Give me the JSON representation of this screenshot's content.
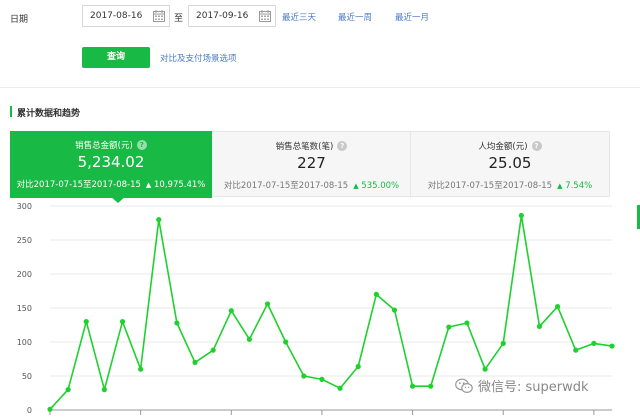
{
  "filter": {
    "date_label": "日期",
    "start_date": "2017-08-16",
    "separator": "至",
    "end_date": "2017-09-16",
    "quick_ranges": [
      "最近三天",
      "最近一周",
      "最近一月"
    ],
    "query_button": "查询",
    "compare_link": "对比及支付场景选项"
  },
  "section": {
    "title": "累计数据和趋势"
  },
  "cards": [
    {
      "title": "销售总金额(元)",
      "value": "5,234.02",
      "compare_text": "对比2017-07-15至2017-08-15",
      "change": "10,975.41%",
      "active": true
    },
    {
      "title": "销售总笔数(笔)",
      "value": "227",
      "compare_text": "对比2017-07-15至2017-08-15",
      "change": "535.00%",
      "active": false
    },
    {
      "title": "人均金额(元)",
      "value": "25.05",
      "compare_text": "对比2017-07-15至2017-08-15",
      "change": "7.54%",
      "active": false
    }
  ],
  "chart_data": {
    "type": "line",
    "ylim": [
      0,
      300
    ],
    "y_ticks": [
      "0",
      "50",
      "100",
      "150",
      "200",
      "250",
      "300"
    ],
    "grid": true,
    "series_color": "#1fd12e",
    "values": [
      1,
      30,
      130,
      30,
      130,
      60,
      280,
      128,
      70,
      88,
      146,
      104,
      156,
      100,
      50,
      45,
      32,
      64,
      170,
      147,
      35,
      35,
      122,
      128,
      60,
      98,
      286,
      123,
      152,
      88,
      98,
      94
    ]
  },
  "watermark": {
    "text": "微信号: superwdk"
  },
  "colors": {
    "accent": "#18b944",
    "link": "#4b7bc8"
  }
}
